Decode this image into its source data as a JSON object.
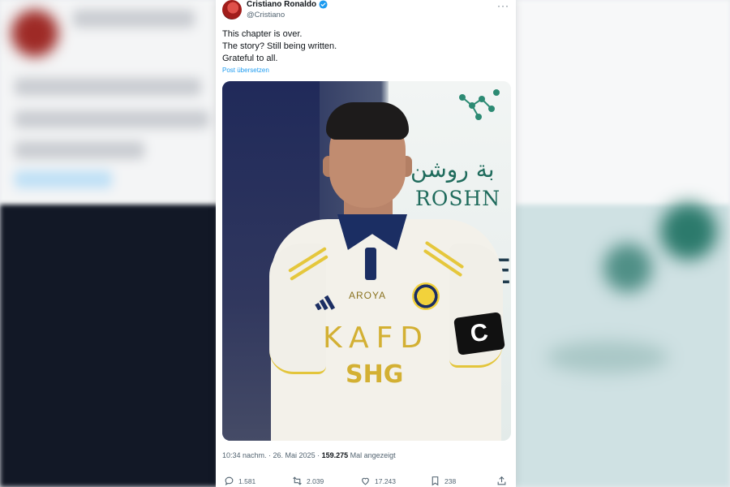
{
  "tweet": {
    "author_name": "Cristiano Ronaldo",
    "author_handle": "@Cristiano",
    "text_lines": [
      "This chapter is over.",
      "The story? Still being written.",
      "Grateful to all."
    ],
    "translate_label": "Post übersetzen",
    "timestamp": "10:34 nachm. · 26. Mai 2025 · ",
    "views_count": "159.275",
    "views_label": " Mal angezeigt"
  },
  "photo": {
    "sponsor_arabic": "بة روشن",
    "sponsor_text": "ROSHN",
    "sponsor_letter": "E",
    "shirt_brand": "AROYA",
    "shirt_sponsor_1": "KAFD",
    "shirt_sponsor_2": "SHG",
    "armband_letter": "C"
  },
  "actions": {
    "replies": "1.581",
    "reposts": "2.039",
    "likes": "17.243",
    "bookmarks": "238"
  },
  "colors": {
    "accent": "#1d9bf0",
    "text_primary": "#0f1419",
    "text_secondary": "#536471"
  }
}
